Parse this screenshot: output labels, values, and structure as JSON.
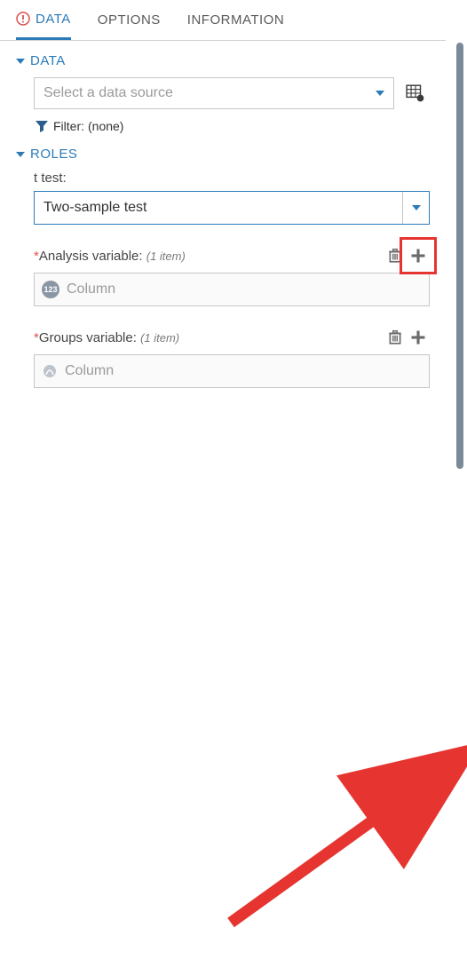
{
  "tabs": {
    "data": "DATA",
    "options": "OPTIONS",
    "information": "INFORMATION"
  },
  "sections": {
    "data": {
      "title": "DATA",
      "select_placeholder": "Select a data source",
      "filter_label": "Filter:",
      "filter_value": "(none)"
    },
    "roles": {
      "title": "ROLES",
      "ttest_label": "t test:",
      "ttest_value": "Two-sample test",
      "analysis": {
        "label": "Analysis variable:",
        "count": "(1 item)",
        "placeholder": "Column",
        "badge": "123"
      },
      "groups": {
        "label": "Groups variable:",
        "count": "(1 item)",
        "placeholder": "Column"
      }
    }
  }
}
